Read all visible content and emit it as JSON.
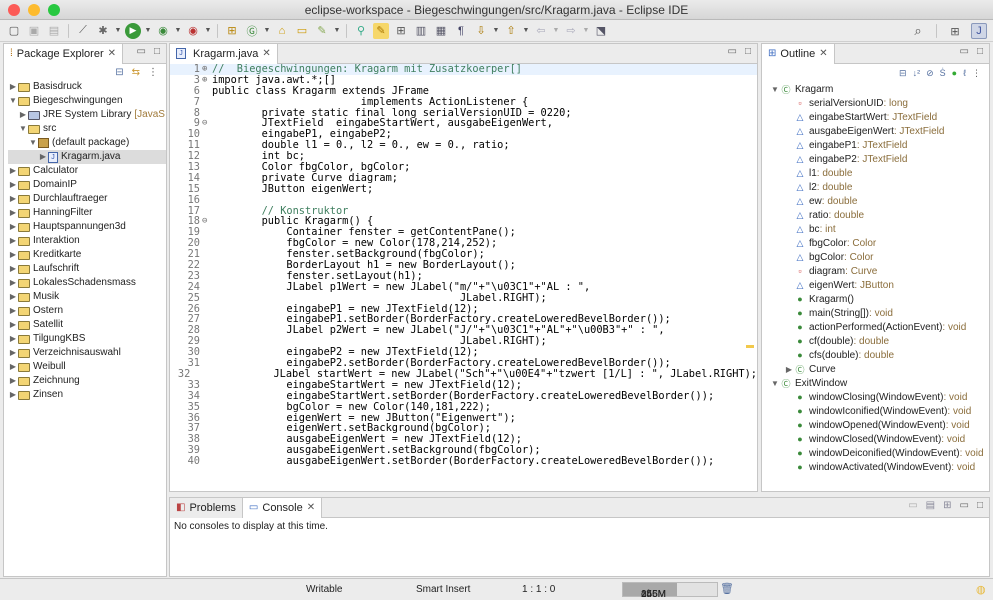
{
  "window": {
    "title": "eclipse-workspace - Biegeschwingungen/src/Kragarm.java - Eclipse IDE"
  },
  "colors": {
    "close": "#fc5b57",
    "minimize": "#fdbb2e",
    "maximize": "#28c840",
    "keyword": "#7f0055",
    "comment": "#3f7f5f",
    "string": "#2a00ff",
    "field": "#0000c0"
  },
  "package_explorer": {
    "tab_label": "Package Explorer",
    "items": [
      {
        "label": "Basisdruck",
        "depth": 0,
        "twisty": "▶",
        "icon": "project-icon"
      },
      {
        "label": "Biegeschwingungen",
        "depth": 0,
        "twisty": "▼",
        "icon": "project-icon"
      },
      {
        "label": "JRE System Library",
        "suffix": "[JavaS",
        "depth": 1,
        "twisty": "▶",
        "icon": "library-icon"
      },
      {
        "label": "src",
        "depth": 1,
        "twisty": "▼",
        "icon": "source-folder-icon"
      },
      {
        "label": "(default package)",
        "depth": 2,
        "twisty": "▼",
        "icon": "package-icon"
      },
      {
        "label": "Kragarm.java",
        "depth": 3,
        "twisty": "▶",
        "icon": "java-file-icon",
        "selected": true
      },
      {
        "label": "Calculator",
        "depth": 0,
        "twisty": "▶",
        "icon": "project-icon"
      },
      {
        "label": "DomainIP",
        "depth": 0,
        "twisty": "▶",
        "icon": "project-icon"
      },
      {
        "label": "Durchlauftraeger",
        "depth": 0,
        "twisty": "▶",
        "icon": "project-icon"
      },
      {
        "label": "HanningFilter",
        "depth": 0,
        "twisty": "▶",
        "icon": "project-icon"
      },
      {
        "label": "Hauptspannungen3d",
        "depth": 0,
        "twisty": "▶",
        "icon": "project-icon"
      },
      {
        "label": "Interaktion",
        "depth": 0,
        "twisty": "▶",
        "icon": "project-icon"
      },
      {
        "label": "Kreditkarte",
        "depth": 0,
        "twisty": "▶",
        "icon": "project-icon"
      },
      {
        "label": "Laufschrift",
        "depth": 0,
        "twisty": "▶",
        "icon": "project-icon"
      },
      {
        "label": "LokalesSchadensmass",
        "depth": 0,
        "twisty": "▶",
        "icon": "project-icon"
      },
      {
        "label": "Musik",
        "depth": 0,
        "twisty": "▶",
        "icon": "project-icon"
      },
      {
        "label": "Ostern",
        "depth": 0,
        "twisty": "▶",
        "icon": "project-icon"
      },
      {
        "label": "Satellit",
        "depth": 0,
        "twisty": "▶",
        "icon": "project-icon"
      },
      {
        "label": "TilgungKBS",
        "depth": 0,
        "twisty": "▶",
        "icon": "project-icon"
      },
      {
        "label": "Verzeichnisauswahl",
        "depth": 0,
        "twisty": "▶",
        "icon": "project-icon"
      },
      {
        "label": "Weibull",
        "depth": 0,
        "twisty": "▶",
        "icon": "project-icon"
      },
      {
        "label": "Zeichnung",
        "depth": 0,
        "twisty": "▶",
        "icon": "project-icon"
      },
      {
        "label": "Zinsen",
        "depth": 0,
        "twisty": "▶",
        "icon": "project-icon"
      }
    ]
  },
  "editor": {
    "tab_label": "Kragarm.java",
    "lines": [
      {
        "n": "1",
        "f": "⊕",
        "t": "//  Biegeschwingungen: Kragarm mit Zusatzkoerper[]",
        "c": "cm"
      },
      {
        "n": "3",
        "f": "⊕",
        "t": "import java.awt.*;[]",
        "c": ""
      },
      {
        "n": "6",
        "f": "",
        "t": "public class Kragarm extends JFrame",
        "c": ""
      },
      {
        "n": "7",
        "f": "",
        "t": "                        implements ActionListener {",
        "c": ""
      },
      {
        "n": "8",
        "f": "",
        "t": "        private static final long serialVersionUID = 0220;",
        "c": ""
      },
      {
        "n": "9",
        "f": "⊖",
        "t": "        JTextField  eingabeStartWert, ausgabeEigenWert,",
        "c": ""
      },
      {
        "n": "10",
        "f": "",
        "t": "        eingabeP1, eingabeP2;",
        "c": ""
      },
      {
        "n": "11",
        "f": "",
        "t": "        double l1 = 0., l2 = 0., ew = 0., ratio;",
        "c": ""
      },
      {
        "n": "12",
        "f": "",
        "t": "        int bc;",
        "c": ""
      },
      {
        "n": "13",
        "f": "",
        "t": "        Color fbgColor, bgColor;",
        "c": ""
      },
      {
        "n": "14",
        "f": "",
        "t": "        private Curve diagram;",
        "c": ""
      },
      {
        "n": "15",
        "f": "",
        "t": "        JButton eigenWert;",
        "c": ""
      },
      {
        "n": "16",
        "f": "",
        "t": "",
        "c": ""
      },
      {
        "n": "17",
        "f": "",
        "t": "        // Konstruktor",
        "c": "cm"
      },
      {
        "n": "18",
        "f": "⊖",
        "t": "        public Kragarm() {",
        "c": ""
      },
      {
        "n": "19",
        "f": "",
        "t": "            Container fenster = getContentPane();",
        "c": ""
      },
      {
        "n": "20",
        "f": "",
        "t": "            fbgColor = new Color(178,214,252);",
        "c": ""
      },
      {
        "n": "21",
        "f": "",
        "t": "            fenster.setBackground(fbgColor);",
        "c": ""
      },
      {
        "n": "22",
        "f": "",
        "t": "            BorderLayout h1 = new BorderLayout();",
        "c": ""
      },
      {
        "n": "23",
        "f": "",
        "t": "            fenster.setLayout(h1);",
        "c": ""
      },
      {
        "n": "24",
        "f": "",
        "t": "            JLabel p1Wert = new JLabel(\"m/\"+\"\\u03C1\"+\"AL : \",",
        "c": ""
      },
      {
        "n": "25",
        "f": "",
        "t": "                                        JLabel.RIGHT);",
        "c": ""
      },
      {
        "n": "26",
        "f": "",
        "t": "            eingabeP1 = new JTextField(12);",
        "c": ""
      },
      {
        "n": "27",
        "f": "",
        "t": "            eingabeP1.setBorder(BorderFactory.createLoweredBevelBorder());",
        "c": ""
      },
      {
        "n": "28",
        "f": "",
        "t": "            JLabel p2Wert = new JLabel(\"J/\"+\"\\u03C1\"+\"AL\"+\"\\u00B3\"+\" : \",",
        "c": ""
      },
      {
        "n": "29",
        "f": "",
        "t": "                                        JLabel.RIGHT);",
        "c": ""
      },
      {
        "n": "30",
        "f": "",
        "t": "            eingabeP2 = new JTextField(12);",
        "c": ""
      },
      {
        "n": "31",
        "f": "",
        "t": "            eingabeP2.setBorder(BorderFactory.createLoweredBevelBorder());",
        "c": ""
      },
      {
        "n": "32",
        "f": "",
        "t": "            JLabel startWert = new JLabel(\"Sch\"+\"\\u00E4\"+\"tzwert [1/L] : \", JLabel.RIGHT);",
        "c": ""
      },
      {
        "n": "33",
        "f": "",
        "t": "            eingabeStartWert = new JTextField(12);",
        "c": ""
      },
      {
        "n": "34",
        "f": "",
        "t": "            eingabeStartWert.setBorder(BorderFactory.createLoweredBevelBorder());",
        "c": ""
      },
      {
        "n": "35",
        "f": "",
        "t": "            bgColor = new Color(140,181,222);",
        "c": ""
      },
      {
        "n": "36",
        "f": "",
        "t": "            eigenWert = new JButton(\"Eigenwert\");",
        "c": ""
      },
      {
        "n": "37",
        "f": "",
        "t": "            eigenWert.setBackground(bgColor);",
        "c": ""
      },
      {
        "n": "38",
        "f": "",
        "t": "            ausgabeEigenWert = new JTextField(12);",
        "c": ""
      },
      {
        "n": "39",
        "f": "",
        "t": "            ausgabeEigenWert.setBackground(fbgColor);",
        "c": ""
      },
      {
        "n": "40",
        "f": "",
        "t": "            ausgabeEigenWert.setBorder(BorderFactory.createLoweredBevelBorder());",
        "c": ""
      }
    ]
  },
  "outline": {
    "tab_label": "Outline",
    "items": [
      {
        "label": "Kragarm",
        "type": "",
        "depth": 0,
        "twisty": "▼",
        "icon": "class-icon"
      },
      {
        "label": "serialVersionUID",
        "type": " : long",
        "depth": 1,
        "icon": "static-final-field-icon"
      },
      {
        "label": "eingabeStartWert",
        "type": " : JTextField",
        "depth": 1,
        "icon": "field-icon"
      },
      {
        "label": "ausgabeEigenWert",
        "type": " : JTextField",
        "depth": 1,
        "icon": "field-icon"
      },
      {
        "label": "eingabeP1",
        "type": " : JTextField",
        "depth": 1,
        "icon": "field-icon"
      },
      {
        "label": "eingabeP2",
        "type": " : JTextField",
        "depth": 1,
        "icon": "field-icon"
      },
      {
        "label": "l1",
        "type": " : double",
        "depth": 1,
        "icon": "field-icon"
      },
      {
        "label": "l2",
        "type": " : double",
        "depth": 1,
        "icon": "field-icon"
      },
      {
        "label": "ew",
        "type": " : double",
        "depth": 1,
        "icon": "field-icon"
      },
      {
        "label": "ratio",
        "type": " : double",
        "depth": 1,
        "icon": "field-icon"
      },
      {
        "label": "bc",
        "type": " : int",
        "depth": 1,
        "icon": "field-icon"
      },
      {
        "label": "fbgColor",
        "type": " : Color",
        "depth": 1,
        "icon": "field-icon"
      },
      {
        "label": "bgColor",
        "type": " : Color",
        "depth": 1,
        "icon": "field-icon"
      },
      {
        "label": "diagram",
        "type": " : Curve",
        "depth": 1,
        "icon": "private-field-icon"
      },
      {
        "label": "eigenWert",
        "type": " : JButton",
        "depth": 1,
        "icon": "field-icon"
      },
      {
        "label": "Kragarm()",
        "type": "",
        "depth": 1,
        "icon": "constructor-icon"
      },
      {
        "label": "main(String[])",
        "type": " : void",
        "depth": 1,
        "icon": "static-method-icon"
      },
      {
        "label": "actionPerformed(ActionEvent)",
        "type": " : void",
        "depth": 1,
        "icon": "method-icon"
      },
      {
        "label": "cf(double)",
        "type": " : double",
        "depth": 1,
        "icon": "method-icon"
      },
      {
        "label": "cfs(double)",
        "type": " : double",
        "depth": 1,
        "icon": "method-icon"
      },
      {
        "label": "Curve",
        "type": "",
        "depth": 1,
        "twisty": "▶",
        "icon": "class-icon"
      },
      {
        "label": "ExitWindow",
        "type": "",
        "depth": 0,
        "twisty": "▼",
        "icon": "class-icon"
      },
      {
        "label": "windowClosing(WindowEvent)",
        "type": " : void",
        "depth": 1,
        "icon": "method-icon"
      },
      {
        "label": "windowIconified(WindowEvent)",
        "type": " : void",
        "depth": 1,
        "icon": "method-icon"
      },
      {
        "label": "windowOpened(WindowEvent)",
        "type": " : void",
        "depth": 1,
        "icon": "method-icon"
      },
      {
        "label": "windowClosed(WindowEvent)",
        "type": " : void",
        "depth": 1,
        "icon": "method-icon"
      },
      {
        "label": "windowDeiconified(WindowEvent)",
        "type": " : void",
        "depth": 1,
        "icon": "method-icon"
      },
      {
        "label": "windowActivated(WindowEvent)",
        "type": " : void",
        "depth": 1,
        "icon": "method-icon"
      }
    ]
  },
  "console": {
    "tabs": [
      {
        "label": "Problems"
      },
      {
        "label": "Console"
      }
    ],
    "message": "No consoles to display at this time."
  },
  "status": {
    "writable": "Writable",
    "insert_mode": "Smart Insert",
    "position": "1 : 1 : 0",
    "heap_used": "145M",
    "heap_of": "of",
    "heap_total": "256M"
  }
}
